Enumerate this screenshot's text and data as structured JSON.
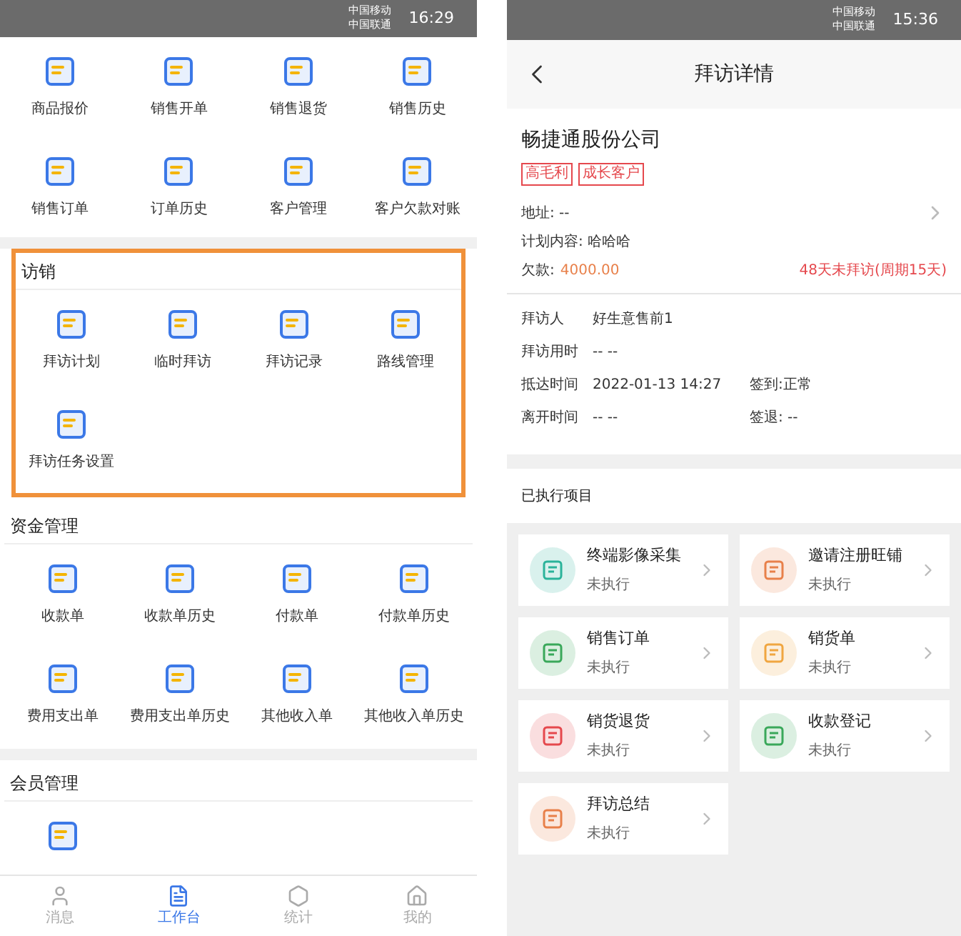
{
  "left_phone": {
    "status_bar": {
      "carriers": [
        "中国移动",
        "中国联通"
      ],
      "time": "16:29"
    },
    "quick_items": [
      "商品报价",
      "销售开单",
      "销售退货",
      "销售历史",
      "销售订单",
      "订单历史",
      "客户管理",
      "客户欠款对账"
    ],
    "sections": [
      {
        "title": "访销",
        "highlighted": true,
        "items": [
          {
            "kind": "labeled",
            "label": "拜访计划"
          },
          {
            "kind": "labeled",
            "label": "临时拜访"
          },
          {
            "kind": "labeled",
            "label": "拜访记录"
          },
          {
            "kind": "labeled",
            "label": "路线管理"
          },
          {
            "kind": "labeled",
            "label": "拜访任务设置"
          }
        ]
      },
      {
        "title": "资金管理",
        "highlighted": false,
        "items": [
          {
            "kind": "labeled",
            "label": "收款单"
          },
          {
            "kind": "labeled",
            "label": "收款单历史"
          },
          {
            "kind": "labeled",
            "label": "付款单"
          },
          {
            "kind": "labeled",
            "label": "付款单历史"
          },
          {
            "kind": "labeled",
            "label": "费用支出单"
          },
          {
            "kind": "labeled",
            "label": "费用支出单历史"
          },
          {
            "kind": "labeled",
            "label": "其他收入单"
          },
          {
            "kind": "labeled",
            "label": "其他收入单历史"
          }
        ]
      },
      {
        "title": "会员管理",
        "highlighted": false,
        "items": [
          {
            "kind": "icon"
          }
        ]
      }
    ],
    "tab_bar": [
      {
        "label": "消息",
        "selected": false
      },
      {
        "label": "工作台",
        "selected": true
      },
      {
        "label": "统计",
        "selected": false
      },
      {
        "label": "我的",
        "selected": false
      }
    ]
  },
  "right_phone": {
    "status_bar": {
      "carriers": [
        "中国移动",
        "中国联通"
      ],
      "time": "15:36"
    },
    "title": "拜访详情",
    "customer": {
      "name": "畅捷通股份公司",
      "tags": [
        "高毛利",
        "成长客户"
      ],
      "address": "地址: --",
      "plan": "计划内容: 哈哈哈",
      "debt_label": "欠款:",
      "debt_value": "4000.00",
      "overdue": "48天未拜访(周期15天)"
    },
    "visit_info": [
      {
        "label": "拜访人",
        "value": "好生意售前1"
      },
      {
        "label": "拜访用时",
        "value": "-- --"
      },
      {
        "label": "抵达时间",
        "value": "2022-01-13 14:27",
        "extra": "签到:正常"
      },
      {
        "label": "离开时间",
        "value": "-- --",
        "extra": "签退: --"
      }
    ],
    "executed_title": "已执行项目",
    "executed_items": [
      {
        "name": "终端影像采集",
        "status": "未执行",
        "color": "#2bb39a"
      },
      {
        "name": "邀请注册旺铺",
        "status": "未执行",
        "color": "#e8804a"
      },
      {
        "name": "销售订单",
        "status": "未执行",
        "color": "#3aa85a"
      },
      {
        "name": "销货单",
        "status": "未执行",
        "color": "#f0a640"
      },
      {
        "name": "销货退货",
        "status": "未执行",
        "color": "#e5484d"
      },
      {
        "name": "收款登记",
        "status": "未执行",
        "color": "#3aa85a"
      },
      {
        "name": "拜访总结",
        "status": "未执行",
        "color": "#e8804a"
      }
    ]
  }
}
